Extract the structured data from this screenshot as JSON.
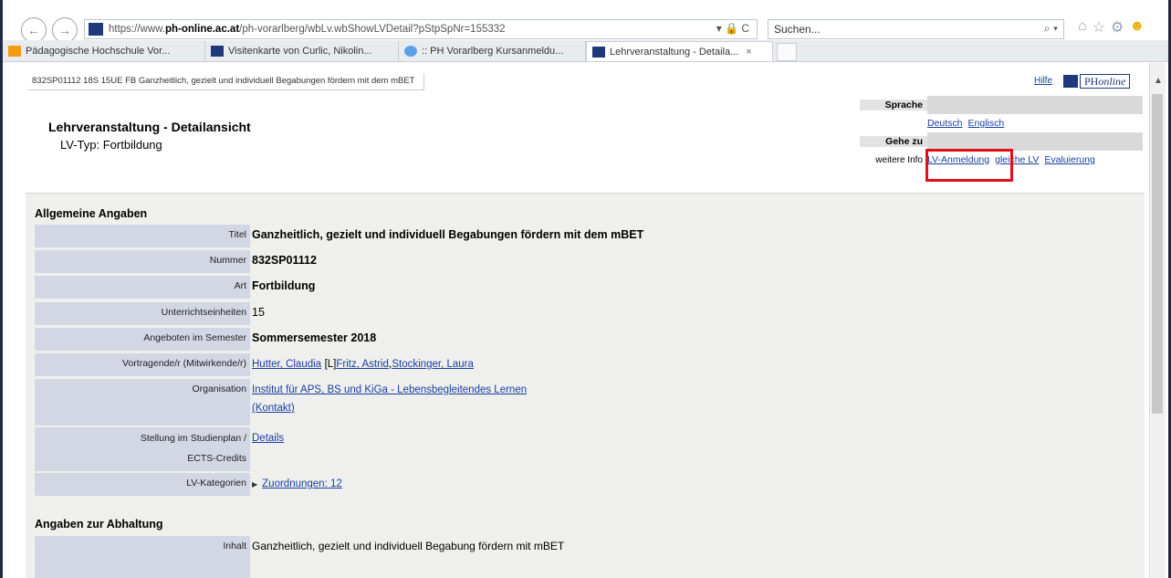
{
  "browser": {
    "url_prefix": "https://www.",
    "url_host": "ph-online.ac.at",
    "url_path": "/ph-vorarlberg/wbLv.wbShowLVDetail?pStpSpNr=155332",
    "url_controls": "▾ 🔒 C",
    "search_placeholder": "Suchen...",
    "search_icon": "⌕ ▾",
    "tabs": [
      {
        "label": "Pädagogische Hochschule Vor...",
        "icon_color": "#f39c12"
      },
      {
        "label": "Visitenkarte von Curlic, Nikolin...",
        "icon_color": "#1e3a7a"
      },
      {
        "label": ":: PH Vorarlberg Kursanmeldu...",
        "icon_color": "#5aa0e8"
      },
      {
        "label": "Lehrveranstaltung - Detaila...",
        "icon_color": "#1e3a7a",
        "close": "×"
      }
    ]
  },
  "page": {
    "breadcrumb": "832SP01112 18S 15UE FB Ganzheitlich, gezielt und individuell Begabungen fördern mit dem mBET",
    "help_link": "Hilfe",
    "logo_prefix": "PH",
    "logo_suffix": "online",
    "title": "Lehrveranstaltung - Detailansicht",
    "subtitle": "LV-Typ: Fortbildung",
    "side": {
      "sprache_label": "Sprache",
      "lang_de": "Deutsch",
      "lang_en": "Englisch",
      "gehezu_label": "Gehe zu",
      "info_label": "weitere Info",
      "link_anmeldung": "LV-Anmeldung",
      "link_gleiche": "gleiche LV",
      "link_eval": "Evaluierung"
    },
    "section_general": "Allgemeine Angaben",
    "fields": {
      "titel_label": "Titel",
      "titel": "Ganzheitlich, gezielt und individuell Begabungen fördern mit dem mBET",
      "nummer_label": "Nummer",
      "nummer": "832SP01112",
      "art_label": "Art",
      "art": "Fortbildung",
      "ue_label": "Unterrichtseinheiten",
      "ue": "15",
      "semester_label": "Angeboten im Semester",
      "semester": "Sommersemester 2018",
      "vortragende_label": "Vortragende/r (Mitwirkende/r)",
      "vortragende_1": "Hutter, Claudia",
      "vortragende_tag": "[L]",
      "vortragende_2": "Fritz, Astrid",
      "vortragende_3": "Stockinger, Laura",
      "org_label": "Organisation",
      "org": "Institut für APS, BS und KiGa - Lebensbegleitendes Lernen",
      "org_contact": "(Kontakt)",
      "stellung_label_1": "Stellung im Studienplan /",
      "stellung_label_2": "ECTS-Credits",
      "stellung": "Details",
      "kat_label": "LV-Kategorien",
      "kat_arrow": "▶",
      "kat": "Zuordnungen: 12"
    },
    "section_abhaltung": "Angaben zur Abhaltung",
    "inhalt_label": "Inhalt",
    "inhalt": "Ganzheitlich, gezielt und individuell Begabung fördern mit mBET"
  }
}
